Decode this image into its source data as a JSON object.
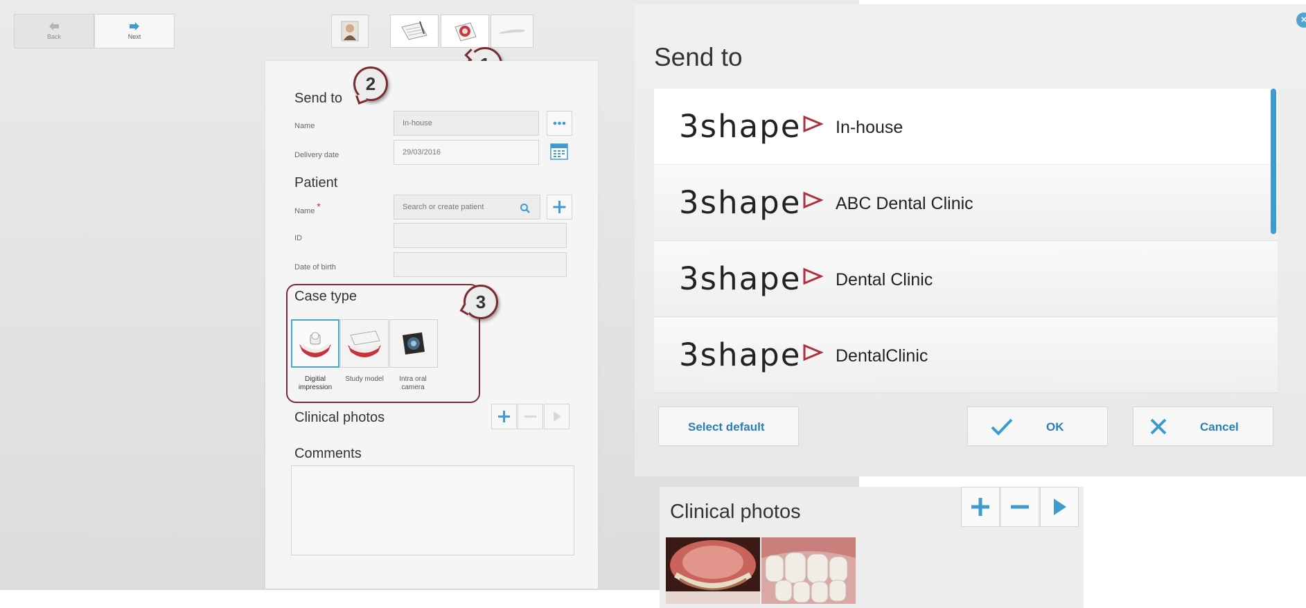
{
  "nav": {
    "back_label": "Back",
    "next_label": "Next"
  },
  "callouts": [
    "1",
    "2",
    "3"
  ],
  "form": {
    "send_to": {
      "title": "Send to",
      "name_label": "Name",
      "name_value": "In-house",
      "delivery_label": "Delivery date",
      "delivery_value": "29/03/2016"
    },
    "patient": {
      "title": "Patient",
      "name_label": "Name",
      "required_mark": "*",
      "search_placeholder": "Search or create patient",
      "id_label": "ID",
      "dob_label": "Date of birth"
    },
    "case_type": {
      "title": "Case type",
      "options": [
        {
          "label": "Digitial impression"
        },
        {
          "label": "Study model"
        },
        {
          "label": "Intra oral camera"
        }
      ]
    },
    "clinical_photos_title": "Clinical photos",
    "comments_title": "Comments"
  },
  "dialog": {
    "title": "Send to",
    "logo_text": "3shape",
    "items": [
      {
        "name": "In-house"
      },
      {
        "name": "ABC Dental Clinic"
      },
      {
        "name": "Dental Clinic"
      },
      {
        "name": "DentalClinic"
      }
    ],
    "select_default_label": "Select default",
    "ok_label": "OK",
    "cancel_label": "Cancel"
  },
  "inset": {
    "title": "Clinical photos"
  },
  "colors": {
    "accent": "#3d9bd0",
    "callout_ring": "#7a2b32",
    "logo_mark": "#b03040"
  }
}
